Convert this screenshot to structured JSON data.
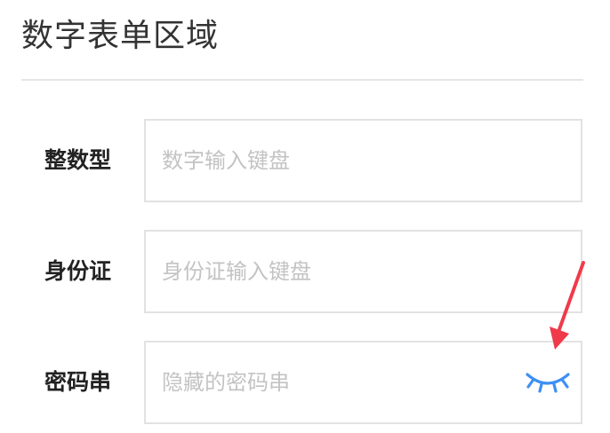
{
  "section": {
    "title": "数字表单区域"
  },
  "fields": [
    {
      "label": "整数型",
      "placeholder": "数字输入键盘",
      "value": ""
    },
    {
      "label": "身份证",
      "placeholder": "身份证输入键盘",
      "value": ""
    },
    {
      "label": "密码串",
      "placeholder": "隐藏的密码串",
      "value": ""
    }
  ],
  "icons": {
    "password_toggle": "eye-closed-icon",
    "annotation": "red-arrow-annotation"
  },
  "colors": {
    "eye_icon": "#3d8ff5",
    "annotation_arrow": "#f03a4a",
    "placeholder": "#c3c3c3",
    "border": "#e2e2e2"
  }
}
